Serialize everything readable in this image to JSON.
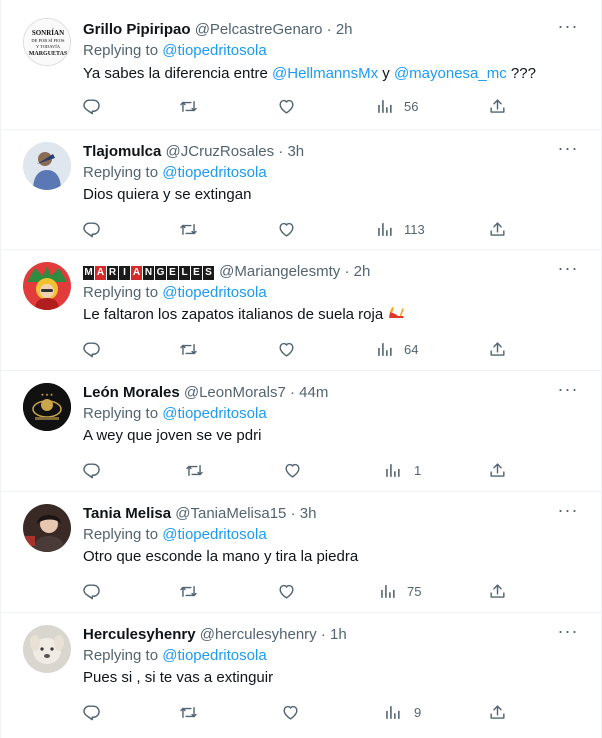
{
  "tweets": [
    {
      "display_name": "Grillo Pipiripao",
      "handle": "@PelcastreGenaro",
      "time": "2h",
      "replying_to_label": "Replying to",
      "replying_to": "@tiopedritosola",
      "text_parts": [
        "Ya sabes la diferencia entre ",
        "@HellmannsMx",
        " y ",
        "@mayonesa_mc",
        " ???"
      ],
      "views": "56",
      "avatar_text": [
        "SONRÍAN",
        "DE POR SÍ FEOS",
        "Y TODAVÍA",
        "MARGUETAS"
      ]
    },
    {
      "display_name": "Tlajomulca",
      "handle": "@JCruzRosales",
      "time": "3h",
      "replying_to_label": "Replying to",
      "replying_to": "@tiopedritosola",
      "text": "Dios quiera y se extingan",
      "views": "113"
    },
    {
      "display_name_boxes": [
        "M",
        "A",
        "R",
        "I",
        "A",
        "N",
        "G",
        "E",
        "L",
        "E",
        "S"
      ],
      "handle": "@Mariangelesmty",
      "time": "2h",
      "replying_to_label": "Replying to",
      "replying_to": "@tiopedritosola",
      "text": "Le faltaron los zapatos italianos de suela roja",
      "views": "64"
    },
    {
      "display_name": "León Morales",
      "handle": "@LeonMorals7",
      "time": "44m",
      "replying_to_label": "Replying to",
      "replying_to": "@tiopedritosola",
      "text": "A wey que joven se ve pdri",
      "views": "1"
    },
    {
      "display_name": "Tania Melisa",
      "handle": "@TaniaMelisa15",
      "time": "3h",
      "replying_to_label": "Replying to",
      "replying_to": "@tiopedritosola",
      "text": "Otro que esconde la mano y tira la piedra",
      "views": "75"
    },
    {
      "display_name": "Herculesyhenry",
      "handle": "@herculesyhenry",
      "time": "1h",
      "replying_to_label": "Replying to",
      "replying_to": "@tiopedritosola",
      "text": "Pues si , si te vas a extinguir",
      "views": "9"
    }
  ],
  "separator": "·",
  "more_glyph": "···",
  "colors": {
    "link": "#1d9bf0",
    "muted": "#536471",
    "text": "#0f1419",
    "divider": "#eff3f4"
  },
  "icons": [
    "reply-icon",
    "retweet-icon",
    "like-icon",
    "views-icon",
    "share-icon",
    "more-icon"
  ]
}
